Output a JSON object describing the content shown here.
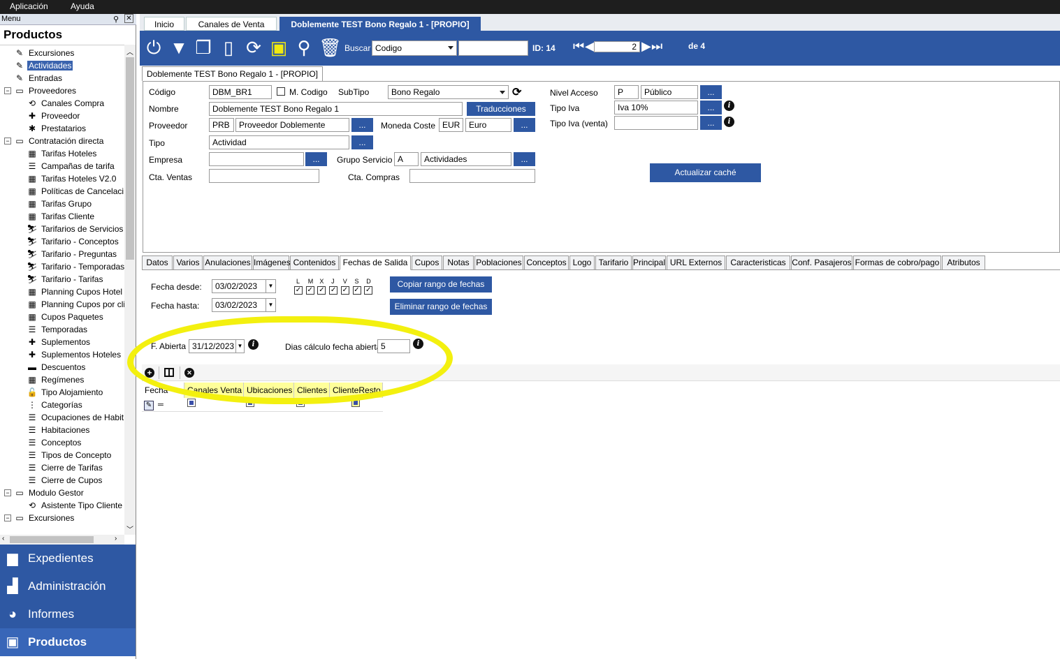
{
  "menubar": {
    "app": "Aplicación",
    "help": "Ayuda"
  },
  "left": {
    "header": "Menu",
    "title": "Productos",
    "tree": [
      {
        "label": "Excursiones",
        "icon": "✎",
        "level": 1,
        "exp": ""
      },
      {
        "label": "Actividades",
        "icon": "✎",
        "level": 1,
        "exp": "",
        "selected": true
      },
      {
        "label": "Entradas",
        "icon": "✎",
        "level": 1,
        "exp": ""
      },
      {
        "label": "Proveedores",
        "icon": "▭",
        "level": 1,
        "exp": "−"
      },
      {
        "label": "Canales Compra",
        "icon": "⟲",
        "level": 2,
        "exp": ""
      },
      {
        "label": "Proveedor",
        "icon": "✚",
        "level": 2,
        "exp": ""
      },
      {
        "label": "Prestatarios",
        "icon": "✱",
        "level": 2,
        "exp": ""
      },
      {
        "label": "Contratación directa",
        "icon": "▭",
        "level": 1,
        "exp": "−"
      },
      {
        "label": "Tarifas Hoteles",
        "icon": "▦",
        "level": 2,
        "exp": ""
      },
      {
        "label": "Campañas de tarifa",
        "icon": "☰",
        "level": 2,
        "exp": ""
      },
      {
        "label": "Tarifas Hoteles V2.0",
        "icon": "▦",
        "level": 2,
        "exp": ""
      },
      {
        "label": "Políticas de Cancelaci",
        "icon": "▦",
        "level": 2,
        "exp": ""
      },
      {
        "label": "Tarifas Grupo",
        "icon": "▦",
        "level": 2,
        "exp": ""
      },
      {
        "label": "Tarifas Cliente",
        "icon": "▦",
        "level": 2,
        "exp": ""
      },
      {
        "label": "Tarifarios de Servicios",
        "icon": "⛷",
        "level": 2,
        "exp": ""
      },
      {
        "label": "Tarifario - Conceptos",
        "icon": "⛷",
        "level": 2,
        "exp": ""
      },
      {
        "label": "Tarifario - Preguntas",
        "icon": "⛷",
        "level": 2,
        "exp": ""
      },
      {
        "label": "Tarifario - Temporadas",
        "icon": "⛷",
        "level": 2,
        "exp": ""
      },
      {
        "label": "Tarifario - Tarifas",
        "icon": "⛷",
        "level": 2,
        "exp": ""
      },
      {
        "label": "Planning Cupos Hotel",
        "icon": "▦",
        "level": 2,
        "exp": ""
      },
      {
        "label": "Planning Cupos por cli",
        "icon": "▦",
        "level": 2,
        "exp": ""
      },
      {
        "label": "Cupos Paquetes",
        "icon": "▦",
        "level": 2,
        "exp": ""
      },
      {
        "label": "Temporadas",
        "icon": "☰",
        "level": 2,
        "exp": ""
      },
      {
        "label": "Suplementos",
        "icon": "✚",
        "level": 2,
        "exp": ""
      },
      {
        "label": "Suplementos Hoteles",
        "icon": "✚",
        "level": 2,
        "exp": ""
      },
      {
        "label": "Descuentos",
        "icon": "▬",
        "level": 2,
        "exp": ""
      },
      {
        "label": "Regímenes",
        "icon": "▦",
        "level": 2,
        "exp": ""
      },
      {
        "label": "Tipo Alojamiento",
        "icon": "🔓",
        "level": 2,
        "exp": ""
      },
      {
        "label": "Categorías",
        "icon": "⋮",
        "level": 2,
        "exp": ""
      },
      {
        "label": "Ocupaciones de Habit",
        "icon": "☰",
        "level": 2,
        "exp": ""
      },
      {
        "label": "Habitaciones",
        "icon": "☰",
        "level": 2,
        "exp": ""
      },
      {
        "label": "Conceptos",
        "icon": "☰",
        "level": 2,
        "exp": ""
      },
      {
        "label": "Tipos de Concepto",
        "icon": "☰",
        "level": 2,
        "exp": ""
      },
      {
        "label": "Cierre de Tarifas",
        "icon": "☰",
        "level": 2,
        "exp": ""
      },
      {
        "label": "Cierre de Cupos",
        "icon": "☰",
        "level": 2,
        "exp": ""
      },
      {
        "label": "Modulo Gestor",
        "icon": "▭",
        "level": 1,
        "exp": "−"
      },
      {
        "label": "Asistente Tipo Cliente",
        "icon": "⟲",
        "level": 2,
        "exp": ""
      },
      {
        "label": "Excursiones",
        "icon": "▭",
        "level": 1,
        "exp": "−"
      }
    ],
    "nav": [
      {
        "label": "Expedientes",
        "icon": "▆"
      },
      {
        "label": "Administración",
        "icon": "▟"
      },
      {
        "label": "Informes",
        "icon": "◕"
      },
      {
        "label": "Productos",
        "icon": "▣"
      }
    ]
  },
  "tabs_top": [
    "Inicio",
    "Canales de Venta",
    "Doblemente TEST Bono Regalo 1 - [PROPIO]"
  ],
  "toolbar": {
    "search_label": "Buscar",
    "search_field": "Codigo",
    "search_value": "",
    "id_label": "ID: 14",
    "record": "2",
    "of_label": "de 4"
  },
  "subtab": "Doblemente TEST Bono Regalo 1 - [PROPIO]",
  "form": {
    "codigo_label": "Código",
    "codigo": "DBM_BR1",
    "mcodigo_label": "M. Codigo",
    "subtipo_label": "SubTipo",
    "subtipo": "Bono Regalo",
    "nombre_label": "Nombre",
    "nombre": "Doblemente TEST Bono Regalo 1",
    "traducciones": "Traducciones",
    "proveedor_label": "Proveedor",
    "prov_code": "PRB",
    "prov_name": "Proveedor Doblemente",
    "moneda_label": "Moneda Coste",
    "moneda_code": "EUR",
    "moneda_name": "Euro",
    "tipo_label": "Tipo",
    "tipo": "Actividad",
    "empresa_label": "Empresa",
    "empresa": "",
    "grupo_label": "Grupo Servicio",
    "grupo_code": "A",
    "grupo_name": "Actividades",
    "ctaventas_label": "Cta. Ventas",
    "ctaventas": "",
    "ctacompras_label": "Cta. Compras",
    "ctacompras": "",
    "nivel_label": "Nivel Acceso",
    "nivel_code": "P",
    "nivel_name": "Público",
    "iva_label": "Tipo Iva",
    "iva": "Iva 10%",
    "ivaventa_label": "Tipo Iva (venta)",
    "ivaventa": "",
    "cache_btn": "Actualizar caché",
    "dots": "..."
  },
  "tabs2": [
    "Datos",
    "Varios",
    "Anulaciones",
    "Imágenes",
    "Contenidos",
    "Fechas de Salida",
    "Cupos",
    "Notas",
    "Poblaciones",
    "Conceptos",
    "Logo",
    "Tarifario",
    "Principal",
    "URL Externos",
    "Caracteristicas",
    "Conf. Pasajeros",
    "Formas de cobro/pago",
    "Atributos"
  ],
  "fechas": {
    "desde_label": "Fecha desde:",
    "desde": "03/02/2023",
    "hasta_label": "Fecha hasta:",
    "hasta": "03/02/2023",
    "days": [
      "L",
      "M",
      "X",
      "J",
      "V",
      "S",
      "D"
    ],
    "copiar": "Copiar rango de fechas",
    "eliminar": "Eliminar rango de fechas",
    "abierta_label": "F. Abierta",
    "abierta": "31/12/2023",
    "dias_label": "Dias cálculo fecha abierta",
    "dias": "5"
  },
  "grid": {
    "headers": [
      "Fecha",
      "Canales Venta",
      "Ubicaciones",
      "Clientes",
      "ClienteResto"
    ]
  },
  "colors": {
    "accent": "#2e58a3",
    "highlight": "#f3f00f"
  }
}
